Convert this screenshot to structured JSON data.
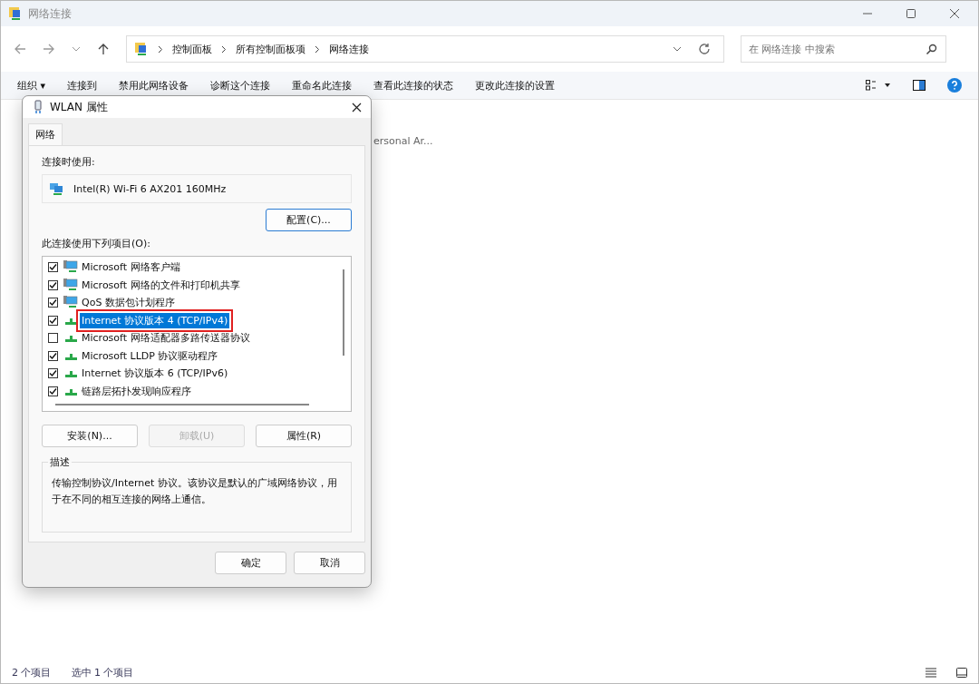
{
  "window": {
    "title": "网络连接"
  },
  "address_bar": {
    "crumbs": [
      "控制面板",
      "所有控制面板项",
      "网络连接"
    ]
  },
  "search": {
    "placeholder": "在 网络连接 中搜索"
  },
  "toolbar": {
    "items": [
      {
        "label": "组织 ▾"
      },
      {
        "label": "连接到"
      },
      {
        "label": "禁用此网络设备"
      },
      {
        "label": "诊断这个连接"
      },
      {
        "label": "重命名此连接"
      },
      {
        "label": "查看此连接的状态"
      },
      {
        "label": "更改此连接的设置"
      }
    ]
  },
  "content": {
    "item_text": "ersonal Ar..."
  },
  "dialog": {
    "title": "WLAN 属性",
    "tabs": [
      {
        "label": "网络",
        "selected": true
      }
    ],
    "connect_using_label": "连接时使用:",
    "adapter": "Intel(R) Wi-Fi 6 AX201 160MHz",
    "configure_button": "配置(C)...",
    "items_label": "此连接使用下列项目(O):",
    "items": [
      {
        "label": "Microsoft 网络客户端",
        "kind": "client",
        "checked": true,
        "selected": false
      },
      {
        "label": "Microsoft 网络的文件和打印机共享",
        "kind": "client",
        "checked": true,
        "selected": false
      },
      {
        "label": "QoS 数据包计划程序",
        "kind": "client",
        "checked": true,
        "selected": false
      },
      {
        "label": "Internet 协议版本 4 (TCP/IPv4)",
        "kind": "protocol",
        "checked": true,
        "selected": true
      },
      {
        "label": "Microsoft 网络适配器多路传送器协议",
        "kind": "protocol",
        "checked": false,
        "selected": false
      },
      {
        "label": "Microsoft LLDP 协议驱动程序",
        "kind": "protocol",
        "checked": true,
        "selected": false
      },
      {
        "label": "Internet 协议版本 6 (TCP/IPv6)",
        "kind": "protocol",
        "checked": true,
        "selected": false
      },
      {
        "label": "链路层拓扑发现响应程序",
        "kind": "protocol",
        "checked": true,
        "selected": false
      }
    ],
    "buttons": [
      {
        "label": "安装(N)...",
        "disabled": false
      },
      {
        "label": "卸载(U)",
        "disabled": true
      },
      {
        "label": "属性(R)",
        "disabled": false
      }
    ],
    "description_label": "描述",
    "description": "传输控制协议/Internet 协议。该协议是默认的广域网络协议，用于在不同的相互连接的网络上通信。",
    "footer_buttons": [
      "确定",
      "取消"
    ]
  },
  "status_bar": {
    "items": [
      "2 个项目",
      "选中 1 个项目"
    ]
  }
}
